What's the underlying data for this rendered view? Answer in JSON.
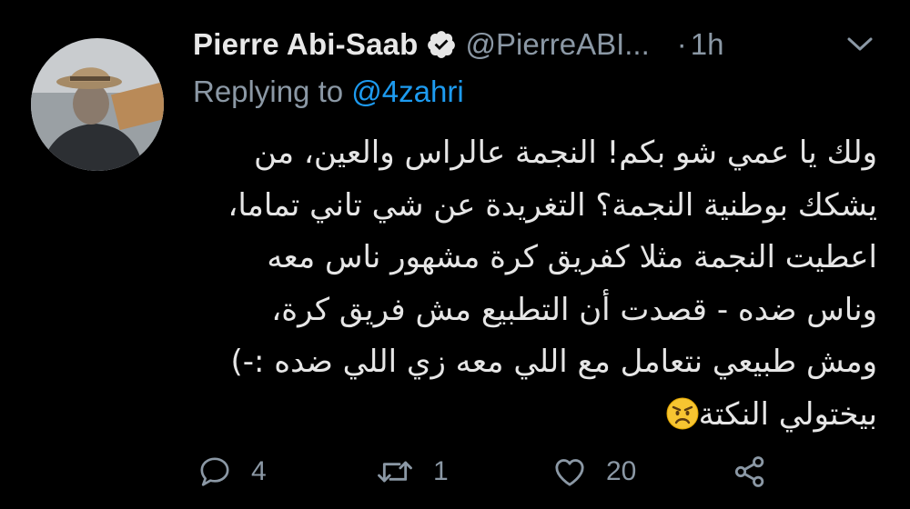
{
  "tweet": {
    "author": {
      "display_name": "Pierre Abi-Saab",
      "handle": "@PierreABI...",
      "verified": true
    },
    "separator": "·",
    "time": "1h",
    "replying_prefix": "Replying to ",
    "replying_to": "@4zahri",
    "body_lines": [
      "ولك يا عمي شو بكم! النجمة عالراس والعين، من",
      "يشكك بوطنية النجمة؟ التغريدة عن شي تاني تماما،",
      "اعطيت النجمة مثلا كفريق كرة مشهور ناس معه",
      "وناس ضده - قصدت أن التطبيع مش فريق كرة،",
      "ومش طبيعي نتعامل مع اللي معه زي اللي ضده :-)",
      "بيختولي النكتة"
    ],
    "emoji": "angry-face-icon",
    "actions": {
      "reply_count": "4",
      "retweet_count": "1",
      "like_count": "20"
    }
  },
  "colors": {
    "background": "#000000",
    "text": "#e6e6e6",
    "muted": "#8b98a5",
    "accent": "#1d9bf0"
  }
}
